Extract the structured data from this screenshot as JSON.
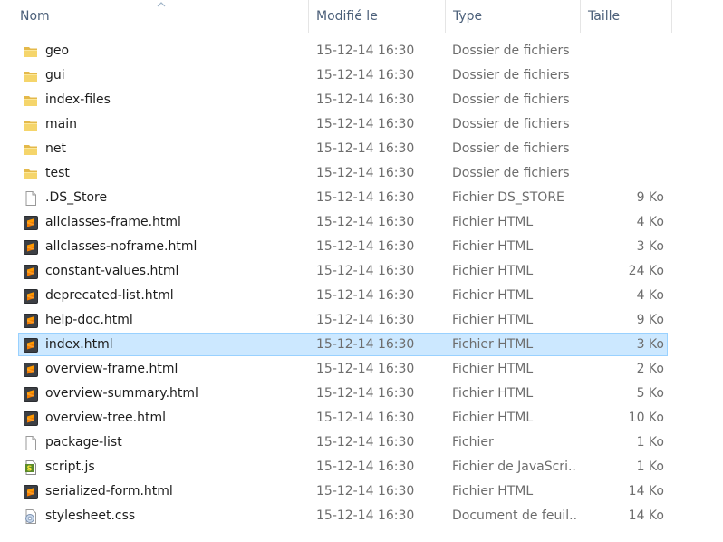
{
  "columns": {
    "name": "Nom",
    "modified": "Modifié le",
    "type": "Type",
    "size": "Taille"
  },
  "files": [
    {
      "name": "geo",
      "modified": "15-12-14 16:30",
      "type": "Dossier de fichiers",
      "size": "",
      "icon": "folder-icon"
    },
    {
      "name": "gui",
      "modified": "15-12-14 16:30",
      "type": "Dossier de fichiers",
      "size": "",
      "icon": "folder-icon"
    },
    {
      "name": "index-files",
      "modified": "15-12-14 16:30",
      "type": "Dossier de fichiers",
      "size": "",
      "icon": "folder-icon"
    },
    {
      "name": "main",
      "modified": "15-12-14 16:30",
      "type": "Dossier de fichiers",
      "size": "",
      "icon": "folder-icon"
    },
    {
      "name": "net",
      "modified": "15-12-14 16:30",
      "type": "Dossier de fichiers",
      "size": "",
      "icon": "folder-icon"
    },
    {
      "name": "test",
      "modified": "15-12-14 16:30",
      "type": "Dossier de fichiers",
      "size": "",
      "icon": "folder-icon"
    },
    {
      "name": ".DS_Store",
      "modified": "15-12-14 16:30",
      "type": "Fichier DS_STORE",
      "size": "9 Ko",
      "icon": "blank-file-icon"
    },
    {
      "name": "allclasses-frame.html",
      "modified": "15-12-14 16:30",
      "type": "Fichier HTML",
      "size": "4 Ko",
      "icon": "sublime-file-icon"
    },
    {
      "name": "allclasses-noframe.html",
      "modified": "15-12-14 16:30",
      "type": "Fichier HTML",
      "size": "3 Ko",
      "icon": "sublime-file-icon"
    },
    {
      "name": "constant-values.html",
      "modified": "15-12-14 16:30",
      "type": "Fichier HTML",
      "size": "24 Ko",
      "icon": "sublime-file-icon"
    },
    {
      "name": "deprecated-list.html",
      "modified": "15-12-14 16:30",
      "type": "Fichier HTML",
      "size": "4 Ko",
      "icon": "sublime-file-icon"
    },
    {
      "name": "help-doc.html",
      "modified": "15-12-14 16:30",
      "type": "Fichier HTML",
      "size": "9 Ko",
      "icon": "sublime-file-icon"
    },
    {
      "name": "index.html",
      "modified": "15-12-14 16:30",
      "type": "Fichier HTML",
      "size": "3 Ko",
      "icon": "sublime-file-icon",
      "selected": true
    },
    {
      "name": "overview-frame.html",
      "modified": "15-12-14 16:30",
      "type": "Fichier HTML",
      "size": "2 Ko",
      "icon": "sublime-file-icon"
    },
    {
      "name": "overview-summary.html",
      "modified": "15-12-14 16:30",
      "type": "Fichier HTML",
      "size": "5 Ko",
      "icon": "sublime-file-icon"
    },
    {
      "name": "overview-tree.html",
      "modified": "15-12-14 16:30",
      "type": "Fichier HTML",
      "size": "10 Ko",
      "icon": "sublime-file-icon"
    },
    {
      "name": "package-list",
      "modified": "15-12-14 16:30",
      "type": "Fichier",
      "size": "1 Ko",
      "icon": "blank-file-icon"
    },
    {
      "name": "script.js",
      "modified": "15-12-14 16:30",
      "type": "Fichier de JavaScri...",
      "size": "1 Ko",
      "icon": "javascript-file-icon"
    },
    {
      "name": "serialized-form.html",
      "modified": "15-12-14 16:30",
      "type": "Fichier HTML",
      "size": "14 Ko",
      "icon": "sublime-file-icon"
    },
    {
      "name": "stylesheet.css",
      "modified": "15-12-14 16:30",
      "type": "Document de feuil...",
      "size": "14 Ko",
      "icon": "css-file-icon"
    }
  ]
}
